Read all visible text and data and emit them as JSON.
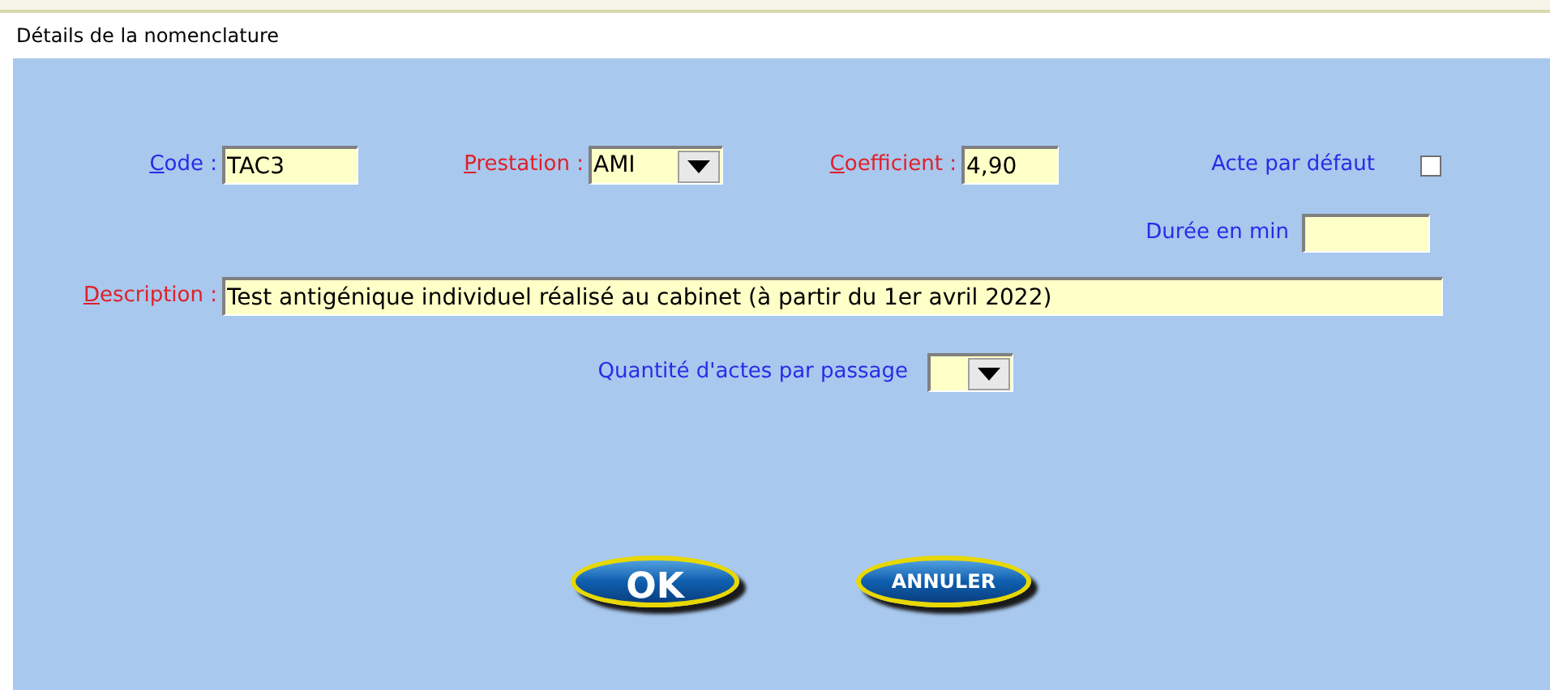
{
  "window": {
    "title": "Détails de la nomenclature"
  },
  "fields": {
    "code": {
      "label": "Code :",
      "required": false,
      "value": "TAC3"
    },
    "prestation": {
      "label": "Prestation :",
      "required": true,
      "value": "AMI"
    },
    "coefficient": {
      "label": "Coefficient :",
      "required": true,
      "value": "4,90"
    },
    "acte_par_defaut": {
      "label": "Acte par défaut",
      "required": false,
      "checked": false
    },
    "duree": {
      "label": "Durée en min",
      "required": false
    },
    "description": {
      "label": "Description :",
      "required": true,
      "value": "Test antigénique individuel réalisé au cabinet (à partir du 1er avril 2022)"
    },
    "quantite": {
      "label": "Quantité d'actes par passage",
      "required": false
    }
  },
  "buttons": [
    {
      "label": "OK",
      "kind": "ok"
    },
    {
      "label": "ANNULER",
      "kind": "cancel"
    }
  ]
}
